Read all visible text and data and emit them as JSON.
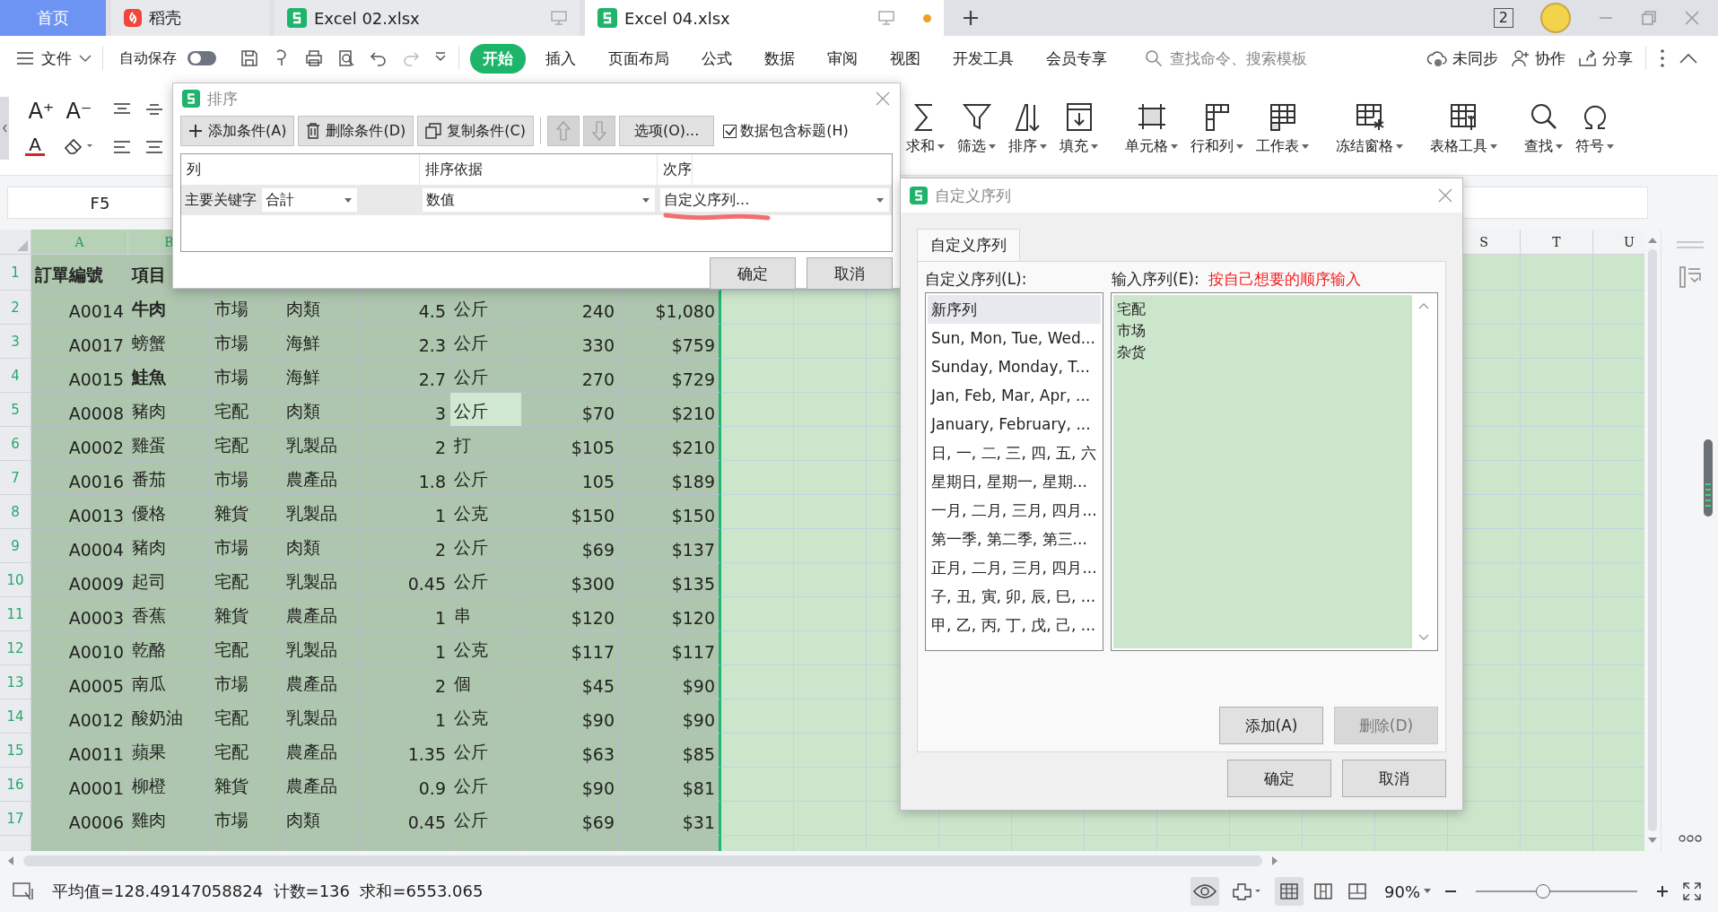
{
  "tabs": [
    {
      "label": "首页",
      "kind": "home",
      "selected": false,
      "unsaved": false
    },
    {
      "label": "稻壳",
      "kind": "docer",
      "selected": false,
      "unsaved": false
    },
    {
      "label": "Excel 02.xlsx",
      "kind": "sheet",
      "selected": false,
      "unsaved": false
    },
    {
      "label": "Excel 04.xlsx",
      "kind": "sheet",
      "selected": true,
      "unsaved": true
    }
  ],
  "window_badge": "2",
  "menu": {
    "file": "文件",
    "autosave": {
      "label": "自动保存",
      "on": false
    },
    "tabs": [
      {
        "label": "开始",
        "selected": true
      },
      {
        "label": "插入",
        "selected": false
      },
      {
        "label": "页面布局",
        "selected": false
      },
      {
        "label": "公式",
        "selected": false
      },
      {
        "label": "数据",
        "selected": false
      },
      {
        "label": "审阅",
        "selected": false
      },
      {
        "label": "视图",
        "selected": false
      },
      {
        "label": "开发工具",
        "selected": false
      },
      {
        "label": "会员专享",
        "selected": false
      }
    ],
    "search": {
      "placeholder": "查找命令、搜索模板"
    },
    "actions": [
      "未同步",
      "协作",
      "分享"
    ]
  },
  "ribbon": {
    "font_tools": [
      "A⁺",
      "A⁻",
      "A"
    ],
    "tools": [
      "求和",
      "筛选",
      "排序",
      "填充",
      "单元格",
      "行和列",
      "工作表",
      "冻结窗格",
      "表格工具",
      "查找",
      "符号"
    ]
  },
  "name_box": "F5",
  "sheet": {
    "row_header": "1",
    "columns_left": [
      "A",
      "B"
    ],
    "columns_right": [
      "S",
      "T",
      "U"
    ],
    "header": [
      "訂單編號",
      "項目"
    ],
    "rows": [
      {
        "n": "2",
        "bold_item": true,
        "unit_selected": false,
        "cells": [
          "A0014",
          "牛肉",
          "市場",
          "肉類",
          "4.5",
          "公斤",
          "240",
          "$1,080"
        ]
      },
      {
        "n": "3",
        "bold_item": false,
        "unit_selected": false,
        "cells": [
          "A0017",
          "螃蟹",
          "市場",
          "海鮮",
          "2.3",
          "公斤",
          "330",
          "$759"
        ]
      },
      {
        "n": "4",
        "bold_item": true,
        "unit_selected": false,
        "cells": [
          "A0015",
          "鮭魚",
          "市場",
          "海鮮",
          "2.7",
          "公斤",
          "270",
          "$729"
        ]
      },
      {
        "n": "5",
        "bold_item": false,
        "unit_selected": true,
        "cells": [
          "A0008",
          "豬肉",
          "宅配",
          "肉類",
          "3",
          "公斤",
          "$70",
          "$210"
        ]
      },
      {
        "n": "6",
        "bold_item": false,
        "unit_selected": false,
        "cells": [
          "A0002",
          "雞蛋",
          "宅配",
          "乳製品",
          "2",
          "打",
          "$105",
          "$210"
        ]
      },
      {
        "n": "7",
        "bold_item": false,
        "unit_selected": false,
        "cells": [
          "A0016",
          "番茄",
          "市場",
          "農產品",
          "1.8",
          "公斤",
          "105",
          "$189"
        ]
      },
      {
        "n": "8",
        "bold_item": false,
        "unit_selected": false,
        "cells": [
          "A0013",
          "優格",
          "雜貨",
          "乳製品",
          "1",
          "公克",
          "$150",
          "$150"
        ]
      },
      {
        "n": "9",
        "bold_item": false,
        "unit_selected": false,
        "cells": [
          "A0004",
          "豬肉",
          "市場",
          "肉類",
          "2",
          "公斤",
          "$69",
          "$137"
        ]
      },
      {
        "n": "10",
        "bold_item": false,
        "unit_selected": false,
        "cells": [
          "A0009",
          "起司",
          "宅配",
          "乳製品",
          "0.45",
          "公斤",
          "$300",
          "$135"
        ]
      },
      {
        "n": "11",
        "bold_item": false,
        "unit_selected": false,
        "cells": [
          "A0003",
          "香蕉",
          "雜貨",
          "農產品",
          "1",
          "串",
          "$120",
          "$120"
        ]
      },
      {
        "n": "12",
        "bold_item": false,
        "unit_selected": false,
        "cells": [
          "A0010",
          "乾酪",
          "宅配",
          "乳製品",
          "1",
          "公克",
          "$117",
          "$117"
        ]
      },
      {
        "n": "13",
        "bold_item": false,
        "unit_selected": false,
        "cells": [
          "A0005",
          "南瓜",
          "市場",
          "農產品",
          "2",
          "個",
          "$45",
          "$90"
        ]
      },
      {
        "n": "14",
        "bold_item": false,
        "unit_selected": false,
        "cells": [
          "A0012",
          "酸奶油",
          "宅配",
          "乳製品",
          "1",
          "公克",
          "$90",
          "$90"
        ]
      },
      {
        "n": "15",
        "bold_item": false,
        "unit_selected": false,
        "cells": [
          "A0011",
          "蘋果",
          "宅配",
          "農產品",
          "1.35",
          "公斤",
          "$63",
          "$85"
        ]
      },
      {
        "n": "16",
        "bold_item": false,
        "unit_selected": false,
        "cells": [
          "A0001",
          "柳橙",
          "雜貨",
          "農產品",
          "0.9",
          "公斤",
          "$90",
          "$81"
        ]
      },
      {
        "n": "17",
        "bold_item": false,
        "unit_selected": false,
        "cells": [
          "A0006",
          "雞肉",
          "市場",
          "肉類",
          "0.45",
          "公斤",
          "$69",
          "$31"
        ]
      }
    ]
  },
  "sort_dialog": {
    "title": "排序",
    "buttons": [
      "添加条件(A)",
      "删除条件(D)",
      "复制条件(C)"
    ],
    "move_disabled": true,
    "options": "选项(O)...",
    "header_row": {
      "label": "数据包含标题(H)",
      "checked": true
    },
    "columns": [
      "列",
      "排序依据",
      "次序"
    ],
    "rule": {
      "key_label": "主要关键字",
      "column": "合計",
      "basis": "数值",
      "order": "自定义序列..."
    },
    "ok": "确定",
    "cancel": "取消"
  },
  "custom_dialog": {
    "title": "自定义序列",
    "tab": {
      "label": "自定义序列",
      "selected": true
    },
    "list_label": "自定义序列(L):",
    "input_label": "输入序列(E):",
    "note": "按自己想要的顺序输入",
    "lists": [
      {
        "label": "新序列",
        "selected": true
      },
      {
        "label": "Sun, Mon, Tue, Wed...",
        "selected": false
      },
      {
        "label": "Sunday, Monday, T...",
        "selected": false
      },
      {
        "label": "Jan, Feb, Mar, Apr, ...",
        "selected": false
      },
      {
        "label": "January, February, ...",
        "selected": false
      },
      {
        "label": "日, 一, 二, 三, 四, 五, 六",
        "selected": false
      },
      {
        "label": "星期日, 星期一, 星期...",
        "selected": false
      },
      {
        "label": "一月, 二月, 三月, 四月...",
        "selected": false
      },
      {
        "label": "第一季, 第二季, 第三...",
        "selected": false
      },
      {
        "label": "正月, 二月, 三月, 四月...",
        "selected": false
      },
      {
        "label": "子, 丑, 寅, 卯, 辰, 巳, ...",
        "selected": false
      },
      {
        "label": "甲, 乙, 丙, 丁, 戊, 己, ...",
        "selected": false
      }
    ],
    "entries": [
      "宅配",
      "市场",
      "杂货"
    ],
    "add": {
      "label": "添加(A)",
      "disabled": false
    },
    "delete": {
      "label": "删除(D)",
      "disabled": true
    },
    "ok": "确定",
    "cancel": "取消"
  },
  "status": {
    "stats": "平均值=128.49147058824  计数=136  求和=6553.065",
    "eye_on": true,
    "views": [
      {
        "selected": true
      },
      {
        "selected": false
      },
      {
        "selected": false
      }
    ],
    "zoom": "90%",
    "zoom_slider": {
      "level": 0.42
    }
  }
}
